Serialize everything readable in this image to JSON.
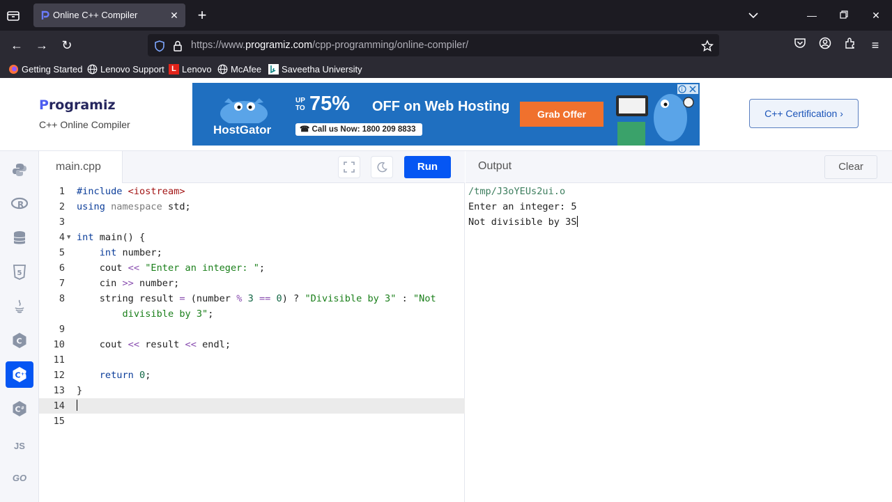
{
  "browser": {
    "tab_title": "Online C++ Compiler",
    "url_scheme_host_prefix": "https://www.",
    "url_host": "programiz.com",
    "url_path": "/cpp-programming/online-compiler/",
    "bookmarks": [
      "Getting Started",
      "Lenovo Support",
      "Lenovo",
      "McAfee",
      "Saveetha University"
    ]
  },
  "header": {
    "logo_letter": "P",
    "logo_rest": "rogramiz",
    "subtitle": "C++ Online Compiler",
    "cert_button": "C++ Certification ›"
  },
  "ad": {
    "up_to": "UP\nTO",
    "percent": "75%",
    "offer": "OFF on Web Hosting",
    "brand": "HostGator",
    "call": "Call us Now: 1800 209 8833",
    "cta": "Grab Offer"
  },
  "languages": [
    "python",
    "r",
    "sql",
    "html",
    "java",
    "c",
    "cpp",
    "csharp",
    "js",
    "go"
  ],
  "languages_labels": {
    "js": "JS",
    "go": "GO"
  },
  "editor": {
    "file_name": "main.cpp",
    "run_label": "Run",
    "active_line": 14,
    "lines": [
      {
        "n": "1",
        "html": "<span class=\"kw\">#include</span> <span class=\"inc\">&lt;iostream&gt;</span>"
      },
      {
        "n": "2",
        "html": "<span class=\"kw\">using</span> <span class=\"kw2\">namespace</span> std;"
      },
      {
        "n": "3",
        "html": ""
      },
      {
        "n": "4",
        "html": "<span class=\"kw\">int</span> main() {",
        "fold": true
      },
      {
        "n": "5",
        "html": "    <span class=\"kw\">int</span> number;"
      },
      {
        "n": "6",
        "html": "    cout <span class=\"op\">&lt;&lt;</span> <span class=\"str\">\"Enter an integer: \"</span>;"
      },
      {
        "n": "7",
        "html": "    cin <span class=\"op\">&gt;&gt;</span> number;"
      },
      {
        "n": "8",
        "html": "    string result <span class=\"op\">=</span> (number <span class=\"op\">%</span> <span class=\"num\">3</span> <span class=\"op\">==</span> <span class=\"num\">0</span>) ? <span class=\"str\">\"Divisible by 3\"</span> : <span class=\"str\">\"Not</span>"
      },
      {
        "n": "",
        "html": "        <span class=\"str\">divisible by 3\"</span>;"
      },
      {
        "n": "9",
        "html": ""
      },
      {
        "n": "10",
        "html": "    cout <span class=\"op\">&lt;&lt;</span> result <span class=\"op\">&lt;&lt;</span> endl;"
      },
      {
        "n": "11",
        "html": ""
      },
      {
        "n": "12",
        "html": "    <span class=\"kw\">return</span> <span class=\"num\">0</span>;"
      },
      {
        "n": "13",
        "html": "}"
      },
      {
        "n": "14",
        "html": ""
      },
      {
        "n": "15",
        "html": ""
      }
    ]
  },
  "output": {
    "title": "Output",
    "clear_label": "Clear",
    "lines": [
      "/tmp/J3oYEUs2ui.o",
      "Enter an integer: 5",
      "Not divisible by 3S"
    ]
  },
  "colors": {
    "accent": "#0556f3",
    "chrome_dark": "#1c1b22",
    "chrome": "#2b2a33"
  }
}
